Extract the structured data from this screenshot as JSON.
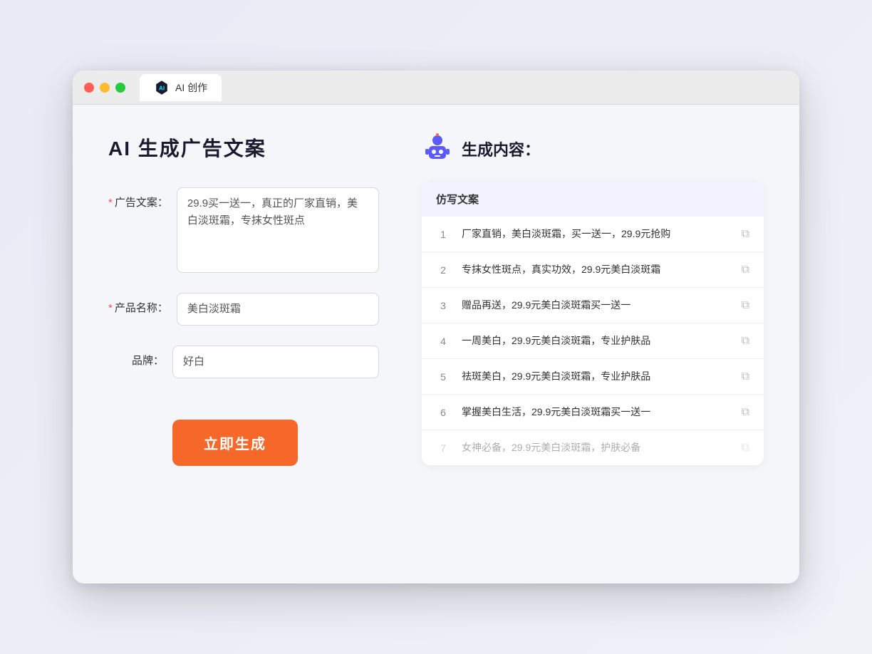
{
  "browser": {
    "tab_label": "AI 创作",
    "traffic_lights": [
      "red",
      "yellow",
      "green"
    ]
  },
  "page": {
    "title": "AI 生成广告文案",
    "form": {
      "ad_copy_label": "广告文案：",
      "ad_copy_required": "*",
      "ad_copy_value": "29.9买一送一，真正的厂家直销，美白淡斑霜，专抹女性斑点",
      "product_label": "产品名称：",
      "product_required": "*",
      "product_value": "美白淡斑霜",
      "brand_label": "品牌：",
      "brand_value": "好白",
      "generate_btn": "立即生成"
    },
    "result": {
      "header_title": "生成内容：",
      "table_column": "仿写文案",
      "items": [
        {
          "num": "1",
          "text": "厂家直销，美白淡斑霜，买一送一，29.9元抢购",
          "faded": false
        },
        {
          "num": "2",
          "text": "专抹女性斑点，真实功效，29.9元美白淡斑霜",
          "faded": false
        },
        {
          "num": "3",
          "text": "赠品再送，29.9元美白淡斑霜买一送一",
          "faded": false
        },
        {
          "num": "4",
          "text": "一周美白，29.9元美白淡斑霜，专业护肤品",
          "faded": false
        },
        {
          "num": "5",
          "text": "祛斑美白，29.9元美白淡斑霜，专业护肤品",
          "faded": false
        },
        {
          "num": "6",
          "text": "掌握美白生活，29.9元美白淡斑霜买一送一",
          "faded": false
        },
        {
          "num": "7",
          "text": "女神必备，29.9元美白淡斑霜，护肤必备",
          "faded": true
        }
      ]
    }
  }
}
